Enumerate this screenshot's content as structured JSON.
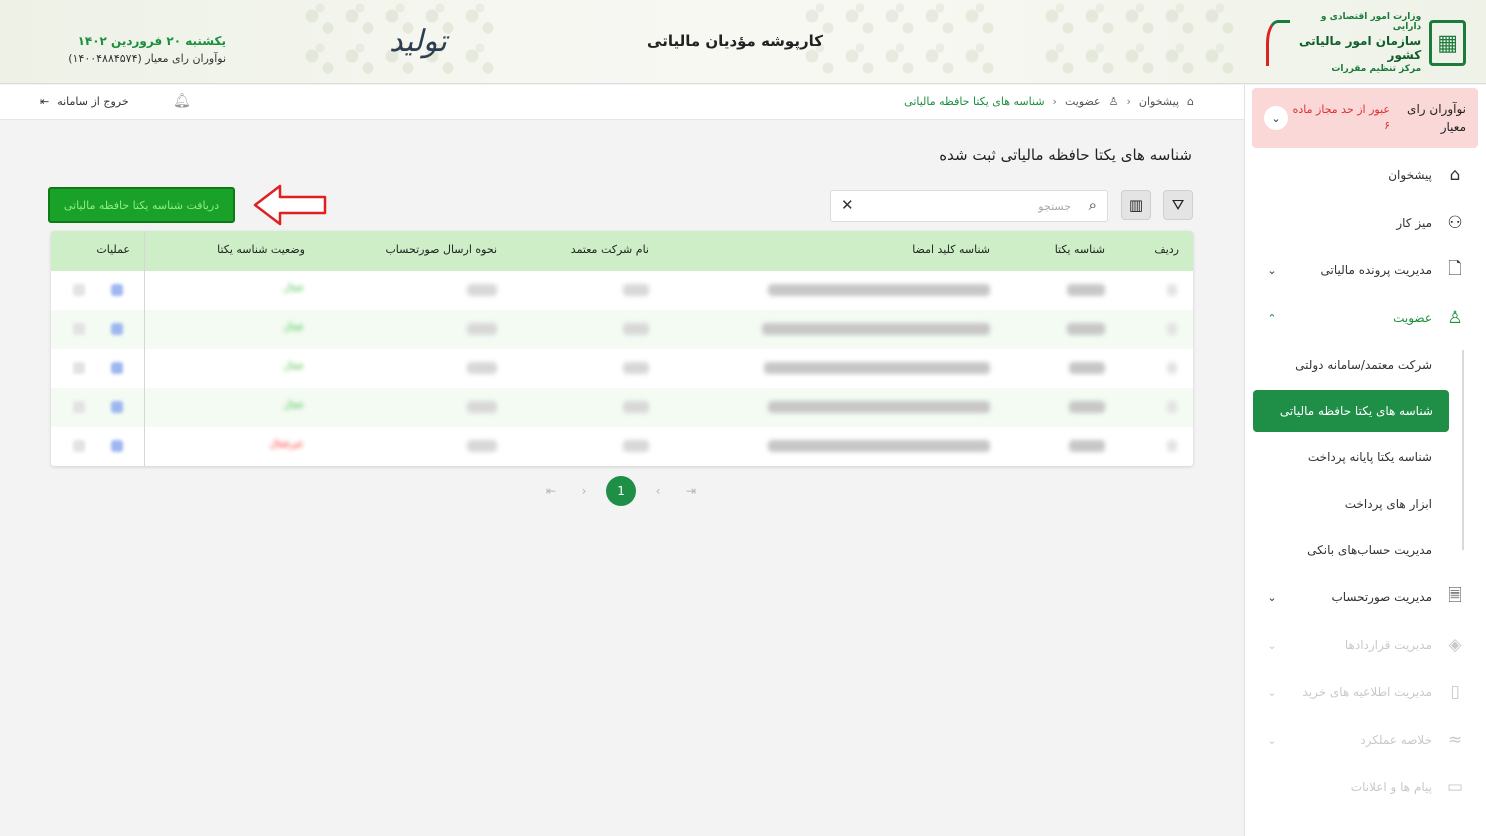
{
  "header": {
    "logo_line1": "وزارت امور اقتصادی و دارایی",
    "logo_line2": "سازمان امور مالیاتی کشور",
    "logo_line3": "مرکز تنظیم مقررات",
    "title": "کارپوشه مؤدیان مالیاتی",
    "tolid_mark": "تولید",
    "date": "یکشنبه ۲۰ فروردین ۱۴۰۲",
    "user": "نوآوران رای معیار (۱۴۰۰۴۸۸۴۵۷۴)"
  },
  "company_card": {
    "name": "نوآوران رای معیار",
    "warning": "عبور از حد مجاز ماده ۶"
  },
  "sidebar": {
    "items": [
      {
        "label": "پیشخوان"
      },
      {
        "label": "میز کار"
      },
      {
        "label": "مدیریت پرونده مالیاتی"
      },
      {
        "label": "عضویت"
      },
      {
        "label": "مدیریت صورتحساب"
      },
      {
        "label": "مدیریت قراردادها"
      },
      {
        "label": "مدیریت اطلاعیه های خرید"
      },
      {
        "label": "خلاصه عملکرد"
      },
      {
        "label": "پیام ها و اعلانات"
      }
    ],
    "sub_items": [
      {
        "label": "شرکت معتمد/سامانه دولتی"
      },
      {
        "label": "شناسه های یکتا حافظه مالیاتی"
      },
      {
        "label": "شناسه یکتا پایانه پرداخت"
      },
      {
        "label": "ابزار های پرداخت"
      },
      {
        "label": "مدیریت حساب‌های بانکی"
      }
    ]
  },
  "topbar": {
    "breadcrumb": [
      "پیشخوان",
      "عضویت",
      "شناسه های یکتا حافظه مالیاتی"
    ],
    "logout": "خروج از سامانه"
  },
  "main": {
    "heading": "شناسه های یکتا حافظه مالیاتی ثبت شده",
    "get_id_button": "دریافت شناسه یکتا حافظه مالیاتی",
    "search_placeholder": "جستجو",
    "table": {
      "columns": [
        "ردیف",
        "شناسه یکتا",
        "شناسه کلید امضا",
        "نام شرکت معتمد",
        "نحوه ارسال صورتحساب",
        "وضعیت شناسه یکتا",
        "عملیات"
      ],
      "rows": [
        {
          "status": "فعال"
        },
        {
          "status": "فعال"
        },
        {
          "status": "فعال"
        },
        {
          "status": "فعال"
        },
        {
          "status": "غیرفعال"
        }
      ]
    },
    "pagination": {
      "current_page": "1"
    }
  },
  "colors": {
    "accent_green": "#1f8f47",
    "header_title_green": "#1a8f3c",
    "warning_bg": "#fbd8d8",
    "warning_text": "#e03030",
    "table_head_bg": "#cdeec7"
  },
  "icons": {
    "home": "home-icon",
    "desk": "workspace-icon",
    "file": "file-icon",
    "user": "user-icon",
    "invoice": "invoice-icon",
    "contract": "handshake-icon",
    "purchase": "clipboard-icon",
    "summary": "chart-icon",
    "messages": "message-icon"
  }
}
